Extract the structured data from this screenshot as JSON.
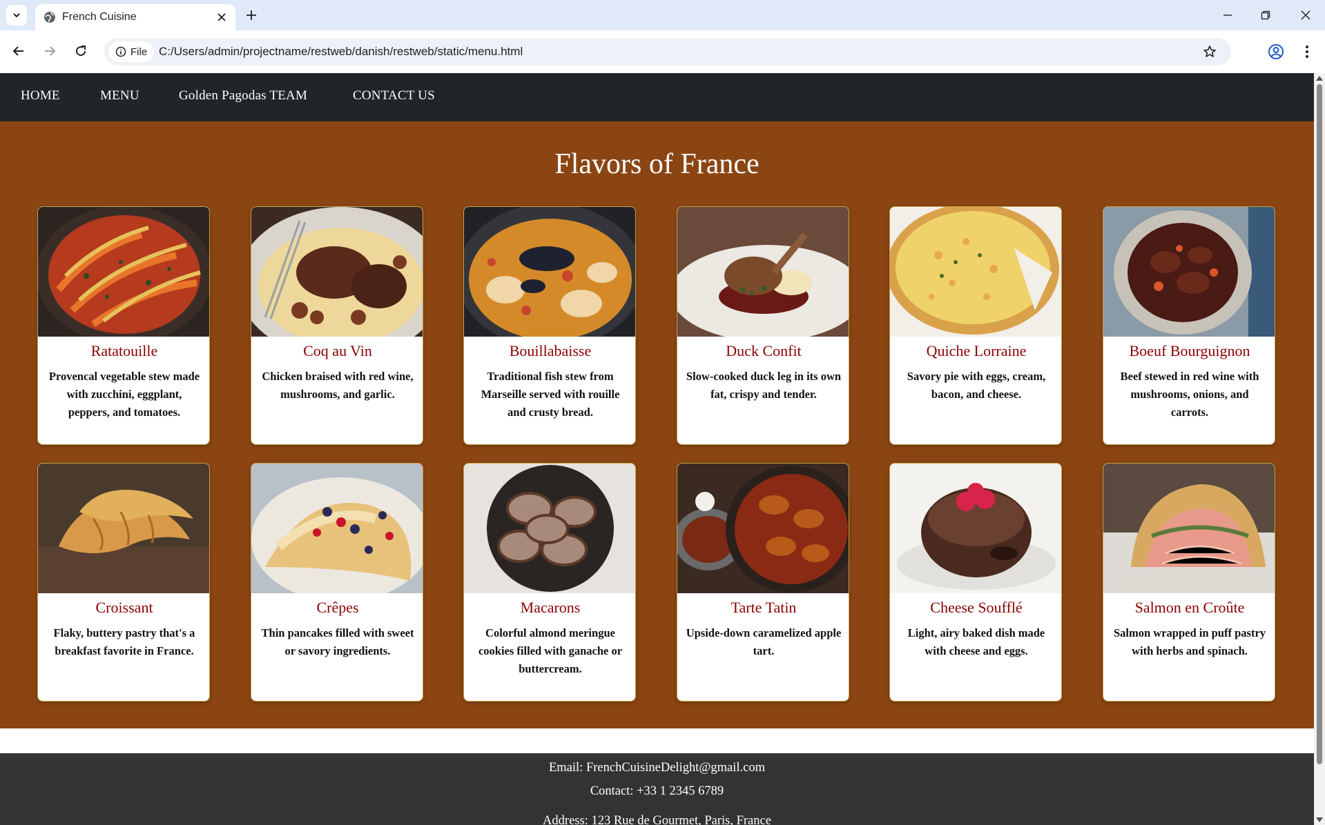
{
  "browser": {
    "tab_title": "French Cuisine",
    "site_chip": "File",
    "url": "C:/Users/admin/projectname/restweb/danish/restweb/static/menu.html"
  },
  "nav": {
    "items": [
      "HOME",
      "MENU",
      "Golden Pagodas TEAM",
      "CONTACT US"
    ]
  },
  "menu": {
    "title": "Flavors of France",
    "dishes": [
      {
        "name": "Ratatouille",
        "description": "Provencal vegetable stew made with zucchini, eggplant, peppers, and tomatoes."
      },
      {
        "name": "Coq au Vin",
        "description": "Chicken braised with red wine, mushrooms, and garlic."
      },
      {
        "name": "Bouillabaisse",
        "description": "Traditional fish stew from Marseille served with rouille and crusty bread."
      },
      {
        "name": "Duck Confit",
        "description": "Slow-cooked duck leg in its own fat, crispy and tender."
      },
      {
        "name": "Quiche Lorraine",
        "description": "Savory pie with eggs, cream, bacon, and cheese."
      },
      {
        "name": "Boeuf Bourguignon",
        "description": "Beef stewed in red wine with mushrooms, onions, and carrots."
      },
      {
        "name": "Croissant",
        "description": "Flaky, buttery pastry that's a breakfast favorite in France."
      },
      {
        "name": "Crêpes",
        "description": "Thin pancakes filled with sweet or savory ingredients."
      },
      {
        "name": "Macarons",
        "description": "Colorful almond meringue cookies filled with ganache or buttercream."
      },
      {
        "name": "Tarte Tatin",
        "description": "Upside-down caramelized apple tart."
      },
      {
        "name": "Cheese Soufflé",
        "description": "Light, airy baked dish made with cheese and eggs."
      },
      {
        "name": "Salmon en Croûte",
        "description": "Salmon wrapped in puff pastry with herbs and spinach."
      }
    ]
  },
  "footer": {
    "email": "Email: FrenchCuisineDelight@gmail.com",
    "contact": "Contact: +33 1 2345 6789",
    "address": "Address: 123 Rue de Gourmet, Paris, France"
  },
  "colors": {
    "nav_bg": "#212529",
    "section_bg": "#8b4513",
    "dish_name": "#8b0000",
    "footer_bg": "#333333"
  }
}
